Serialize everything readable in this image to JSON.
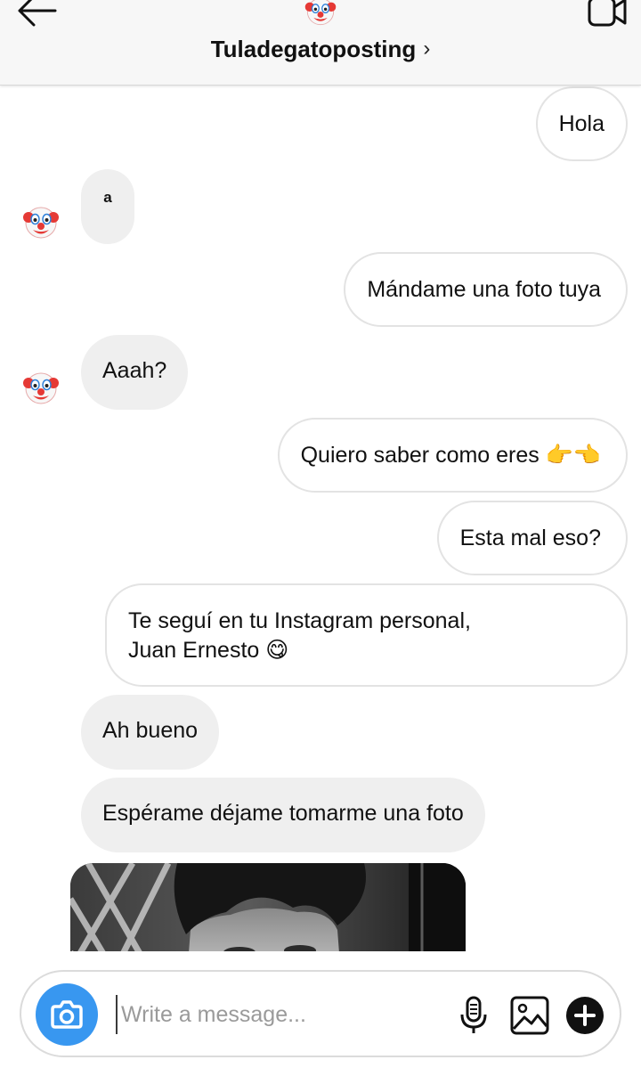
{
  "header": {
    "title": "Tuladegatoposting",
    "chevron": "›",
    "back_icon": "back-arrow-icon",
    "video_icon": "video-call-icon",
    "avatar_icon": "clown-face-icon"
  },
  "messages": [
    {
      "side": "out",
      "text": "Hola"
    },
    {
      "side": "in",
      "text": "a"
    },
    {
      "side": "out",
      "text": "Mándame una foto tuya"
    },
    {
      "side": "in",
      "text": "Aaah?"
    },
    {
      "side": "out",
      "text": "Quiero saber como eres 👉👈"
    },
    {
      "side": "out",
      "text": "Esta mal eso?"
    },
    {
      "side": "out",
      "line1": "Te seguí en tu Instagram personal,",
      "line2": "Juan Ernesto 😋"
    },
    {
      "side": "in",
      "text": "Ah bueno"
    },
    {
      "side": "in",
      "text": "Espérame déjame tomarme una foto"
    }
  ],
  "composer": {
    "placeholder": "Write a message...",
    "value": ""
  },
  "colors": {
    "accent": "#3897f0",
    "incoming_bubble": "#efefef",
    "outgoing_border": "#e3e3e3",
    "header_bg": "#f7f7f7"
  }
}
